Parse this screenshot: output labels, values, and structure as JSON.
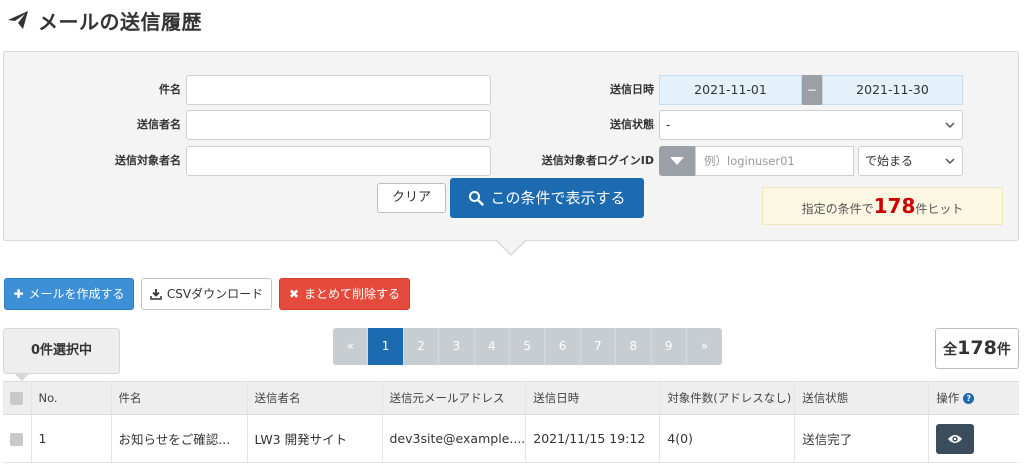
{
  "page": {
    "title": "メールの送信履歴"
  },
  "search": {
    "subject_label": "件名",
    "sender_label": "送信者名",
    "target_label": "送信対象者名",
    "date_label": "送信日時",
    "date_from": "2021-11-01",
    "date_sep": "−",
    "date_to": "2021-11-30",
    "status_label": "送信状態",
    "status_value": "-",
    "login_label": "送信対象者ログインID",
    "login_placeholder": "例）loginuser01",
    "match_value": "で始まる",
    "clear_label": "クリア",
    "search_label": "この条件で表示する",
    "hit_prefix": "指定の条件で",
    "hit_count": "178",
    "hit_suffix": "件ヒット"
  },
  "actions": {
    "compose_label": "メールを作成する",
    "csv_label": "CSVダウンロード",
    "delete_label": "まとめて削除する"
  },
  "selection": {
    "label": "0件選択中"
  },
  "pagination": {
    "prev": "«",
    "pages": [
      "1",
      "2",
      "3",
      "4",
      "5",
      "6",
      "7",
      "8",
      "9"
    ],
    "next": "»",
    "current": "1"
  },
  "total": {
    "prefix": "全",
    "count": "178",
    "suffix": "件"
  },
  "table": {
    "headers": [
      "No.",
      "件名",
      "送信者名",
      "送信元メールアドレス",
      "送信日時",
      "対象件数(アドレスなし)",
      "送信状態",
      "操作"
    ],
    "rows": [
      {
        "no": "1",
        "subject": "お知らせをご確認...",
        "sender": "LW3 開発サイト",
        "from": "dev3site@example....",
        "sent_at": "2021/11/15 19:12",
        "count": "4(0)",
        "status": "送信完了"
      }
    ]
  },
  "colors": {
    "primary": "#1c6ab0",
    "compose": "#3d8fd6",
    "danger": "#e54b3c",
    "hit": "#cc0000"
  }
}
